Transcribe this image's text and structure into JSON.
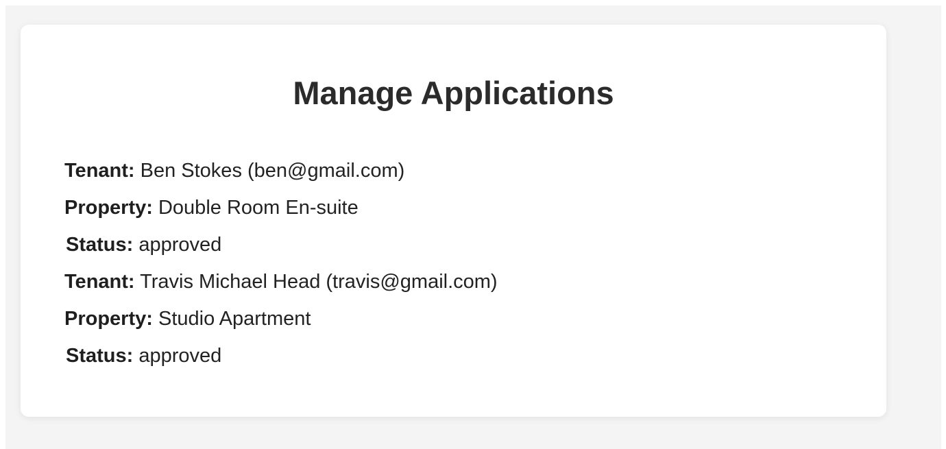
{
  "page": {
    "title": "Manage Applications"
  },
  "labels": {
    "tenant": "Tenant:",
    "property": "Property:",
    "status": "Status:"
  },
  "applications": [
    {
      "tenant": "Ben Stokes (ben@gmail.com)",
      "property": "Double Room En-suite",
      "status": "approved"
    },
    {
      "tenant": "Travis Michael Head (travis@gmail.com)",
      "property": "Studio Apartment",
      "status": "approved"
    }
  ],
  "colors": {
    "page_background": "#f4f4f4",
    "card_background": "#ffffff",
    "text": "#222222"
  }
}
